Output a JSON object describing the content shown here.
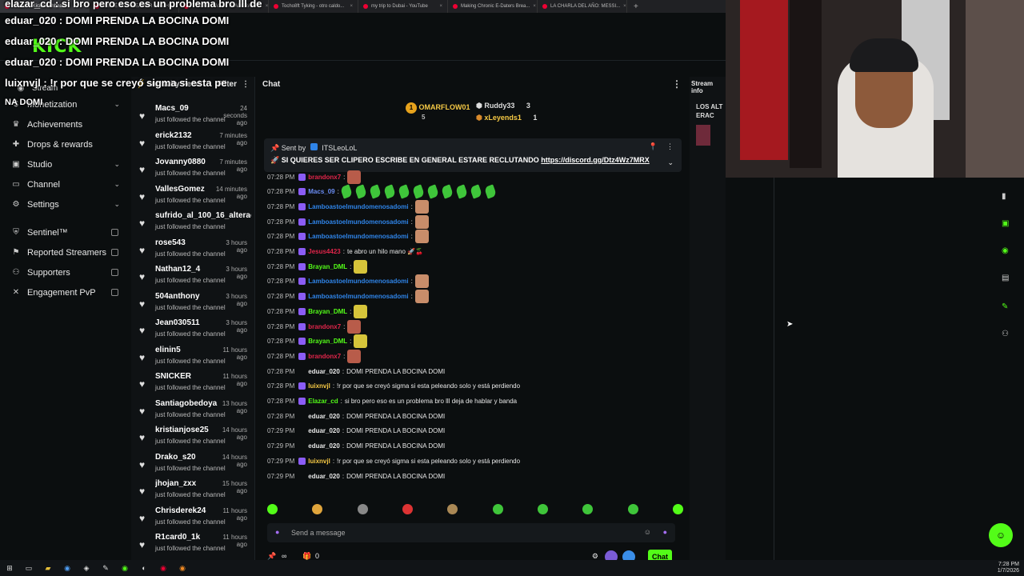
{
  "browser": {
    "tabs": [
      {
        "label": "Stream - Kick Dashboard"
      },
      {
        "label": "VISITÉ AL STREAMER MÁS HU..."
      },
      {
        "label": "TYKING CANTA TRADERA PA..."
      },
      {
        "label": "Tocho8ft Tyking - otro caldo..."
      },
      {
        "label": "my trip to Dubai - YouTube"
      },
      {
        "label": "Making Chronic E-Daters Brea..."
      },
      {
        "label": "LA CHARLA DEL AÑO: MESSI..."
      }
    ],
    "new_tab": "+"
  },
  "overlay_chat": [
    "elazar_cd : si bro pero eso es un problema bro lll de",
    "eduar_020 : DOMI PRENDA LA BOCINA DOMI",
    "eduar_020 : DOMI PRENDA LA BOCINA DOMI",
    "eduar_020 : DOMI PRENDA LA BOCINA DOMI",
    "luixnvjl : !r por que se creyó sigma si esta pe",
    "NA DOMI"
  ],
  "sidebar": {
    "stream_label": "Stream",
    "items": [
      {
        "label": "Monetization",
        "icon": "dollar",
        "chevron": true
      },
      {
        "label": "Achievements",
        "icon": "trophy"
      },
      {
        "label": "Drops & rewards",
        "icon": "gift"
      },
      {
        "label": "Studio",
        "icon": "video",
        "chevron": true
      },
      {
        "label": "Channel",
        "icon": "tv",
        "chevron": true
      },
      {
        "label": "Settings",
        "icon": "gear",
        "chevron": true
      },
      {
        "label": "Sentinel™",
        "icon": "shield",
        "external": true
      },
      {
        "label": "Reported Streamers",
        "icon": "flag",
        "external": true
      },
      {
        "label": "Supporters",
        "icon": "users",
        "external": true
      },
      {
        "label": "Engagement PvP",
        "icon": "swords",
        "external": true
      }
    ]
  },
  "activity_feed": {
    "title": "Activity Feed",
    "filter": "Filter",
    "events": [
      {
        "name": "Macs_09",
        "time": "24 seconds ago",
        "desc": "just followed the channel"
      },
      {
        "name": "erick2132",
        "time": "7 minutes ago",
        "desc": "just followed the channel"
      },
      {
        "name": "Jovanny0880",
        "time": "7 minutes ago",
        "desc": "just followed the channel"
      },
      {
        "name": "VallesGomez",
        "time": "14 minutes ago",
        "desc": "just followed the channel"
      },
      {
        "name": "sufrido_al_100_16_alterao",
        "time": "",
        "desc": "just followed the channel"
      },
      {
        "name": "rose543",
        "time": "3 hours ago",
        "desc": "just followed the channel"
      },
      {
        "name": "Nathan12_4",
        "time": "3 hours ago",
        "desc": "just followed the channel"
      },
      {
        "name": "504anthony",
        "time": "3 hours ago",
        "desc": "just followed the channel"
      },
      {
        "name": "Jean030511",
        "time": "3 hours ago",
        "desc": "just followed the channel"
      },
      {
        "name": "elinin5",
        "time": "11 hours ago",
        "desc": "just followed the channel"
      },
      {
        "name": "SNICKER",
        "time": "11 hours ago",
        "desc": "just followed the channel"
      },
      {
        "name": "Santiagobedoya",
        "time": "13 hours ago",
        "desc": "just followed the channel"
      },
      {
        "name": "kristianjose25",
        "time": "14 hours ago",
        "desc": "just followed the channel"
      },
      {
        "name": "Drako_s20",
        "time": "14 hours ago",
        "desc": "just followed the channel"
      },
      {
        "name": "jhojan_zxx",
        "time": "15 hours ago",
        "desc": "just followed the channel"
      },
      {
        "name": "Chrisderek24",
        "time": "11 hours ago",
        "desc": "just followed the channel"
      },
      {
        "name": "R1card0_1k",
        "time": "11 hours ago",
        "desc": "just followed the channel"
      }
    ]
  },
  "chat": {
    "title": "Chat",
    "leaderboard": [
      {
        "rank": "1",
        "name": "OMARFLOW01",
        "count": "5"
      },
      {
        "name": "Ruddy33",
        "count": "3"
      },
      {
        "name": "xLeyends1",
        "count": "1"
      }
    ],
    "pinned": {
      "sent_by_label": "Sent by",
      "sender": "ITSLeoLoL",
      "text": "SI QUIERES SER CLIPERO ESCRIBE EN GENERAL ESTARE RECLUTANDO",
      "link": "https://discord.gg/Dtz4Wz7MRX"
    },
    "messages": [
      {
        "time": "07:28 PM",
        "user": "brandonx7",
        "color": "#e0254a",
        "text": "",
        "emote": "#b85c4a"
      },
      {
        "time": "07:28 PM",
        "user": "Macs_09",
        "color": "#6a8cf2",
        "text": "",
        "leaves": 11
      },
      {
        "time": "07:28 PM",
        "user": "Lamboastoelmundomenosadomi",
        "color": "#2f84e8",
        "text": "",
        "emote": "#c88d6a"
      },
      {
        "time": "07:28 PM",
        "user": "Lamboastoelmundomenosadomi",
        "color": "#2f84e8",
        "text": "",
        "emote": "#c88d6a"
      },
      {
        "time": "07:28 PM",
        "user": "Lamboastoelmundomenosadomi",
        "color": "#2f84e8",
        "text": "",
        "emote": "#c88d6a"
      },
      {
        "time": "07:28 PM",
        "user": "Jesus4423",
        "color": "#e0254a",
        "text": "te abro un hilo mano 🚀🍒"
      },
      {
        "time": "07:28 PM",
        "user": "Brayan_DML",
        "color": "#53fc18",
        "text": "",
        "emote": "#d6c43a"
      },
      {
        "time": "07:28 PM",
        "user": "Lamboastoelmundomenosadomi",
        "color": "#2f84e8",
        "text": "",
        "emote": "#c88d6a"
      },
      {
        "time": "07:28 PM",
        "user": "Lamboastoelmundomenosadomi",
        "color": "#2f84e8",
        "text": "",
        "emote": "#c88d6a"
      },
      {
        "time": "07:28 PM",
        "user": "Brayan_DML",
        "color": "#53fc18",
        "text": "",
        "emote": "#d6c43a"
      },
      {
        "time": "07:28 PM",
        "user": "brandonx7",
        "color": "#e0254a",
        "text": "",
        "emote": "#b85c4a"
      },
      {
        "time": "07:28 PM",
        "user": "Brayan_DML",
        "color": "#53fc18",
        "text": "",
        "emote": "#d6c43a"
      },
      {
        "time": "07:28 PM",
        "user": "brandonx7",
        "color": "#e0254a",
        "text": "",
        "emote": "#b85c4a"
      },
      {
        "time": "07:28 PM",
        "user": "eduar_020",
        "color": "#e8e8e8",
        "text": "DOMI PRENDA LA BOCINA DOMI"
      },
      {
        "time": "07:28 PM",
        "user": "luixnvjl",
        "color": "#f6c945",
        "text": "!r por que se creyó sigma si esta peleando solo y está perdiendo"
      },
      {
        "time": "07:28 PM",
        "user": "Elazar_cd",
        "color": "#53fc18",
        "text": "si bro pero eso es un problema bro lll deja de hablar y banda"
      },
      {
        "time": "07:28 PM",
        "user": "eduar_020",
        "color": "#e8e8e8",
        "text": "DOMI PRENDA LA BOCINA DOMI"
      },
      {
        "time": "07:29 PM",
        "user": "eduar_020",
        "color": "#e8e8e8",
        "text": "DOMI PRENDA LA BOCINA DOMI"
      },
      {
        "time": "07:29 PM",
        "user": "eduar_020",
        "color": "#e8e8e8",
        "text": "DOMI PRENDA LA BOCINA DOMI"
      },
      {
        "time": "07:29 PM",
        "user": "luixnvjl",
        "color": "#f6c945",
        "text": "!r por que se creyó sigma si esta peleando solo y está perdiendo"
      },
      {
        "time": "07:29 PM",
        "user": "eduar_020",
        "color": "#e8e8e8",
        "text": "DOMI PRENDA LA BOCINA DOMI"
      }
    ],
    "send_placeholder": "Send a message",
    "points": "0",
    "chat_button": "Chat"
  },
  "stream_info": {
    "title": "Stream info",
    "snippet": "LOS ALTERAC"
  },
  "taskbar": {
    "time": "7:28 PM",
    "date": "1/7/2026"
  },
  "colors": {
    "kick_green": "#53fc18",
    "bg": "#0b0e0f"
  }
}
